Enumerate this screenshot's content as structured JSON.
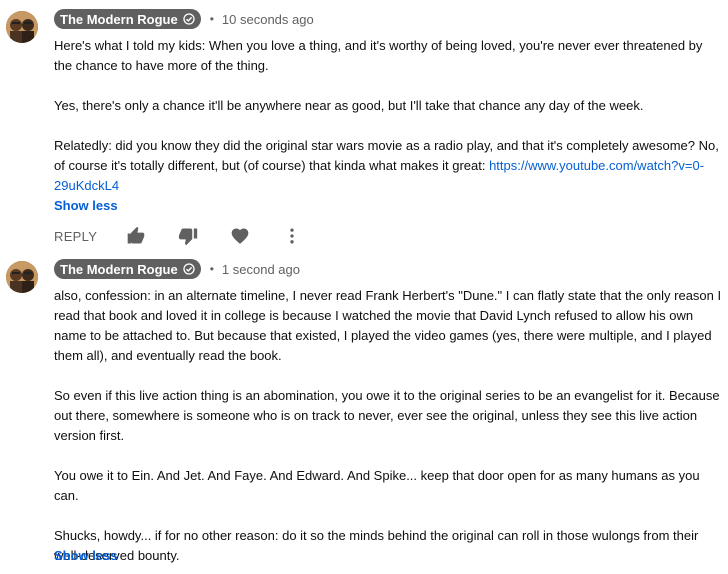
{
  "comments": [
    {
      "author": "The Modern Rogue",
      "separator": "•",
      "time": "10 seconds ago",
      "paragraphs": [
        "Here's what I told my kids:  When you love a thing, and it's worthy of being loved, you're never ever threatened by the chance to have more of the thing.",
        "Yes, there's only a chance it'll be anywhere near as good, but I'll take that chance any day of the week."
      ],
      "last_paragraph_text": "Relatedly:  did you know they did the original star wars movie as a radio play, and that it's completely awesome?  No, of course it's totally different, but (of course) that kinda what makes it great:  ",
      "link": "https://www.youtube.com/watch?v=0-29uKdckL4",
      "show_less": "Show less",
      "reply_label": "REPLY"
    },
    {
      "author": "The Modern Rogue",
      "separator": "•",
      "time": "1 second ago",
      "paragraphs": [
        "also, confession:  in an alternate timeline, I never read Frank Herbert's \"Dune.\"  I can flatly state that the only reason I read that book and loved it in college is because I watched the movie that David Lynch refused to allow his own name to be attached to.  But because that existed, I played the video games (yes, there were multiple, and I played them all), and eventually read the book.",
        "So even if this live action thing is an abomination, you owe it to the original series to be an evangelist for it.  Because out there, somewhere is someone who is on track to never, ever see the original, unless they see this live action version first.",
        "You owe it to Ein. And Jet. And Faye. And Edward. And Spike... keep that door open for as many humans as you can.",
        "Shucks, howdy... if for no other reason: do it so the minds behind the original can roll in those wulongs from their well-deserved bounty."
      ],
      "show_less": "Show less"
    }
  ],
  "icons": {
    "verified": "verified-check-icon",
    "like": "thumbs-up-icon",
    "dislike": "thumbs-down-icon",
    "heart": "heart-icon",
    "more": "more-vert-icon"
  },
  "colors": {
    "link": "#065fd4",
    "badge_bg": "#606060",
    "meta_text": "#606060"
  }
}
